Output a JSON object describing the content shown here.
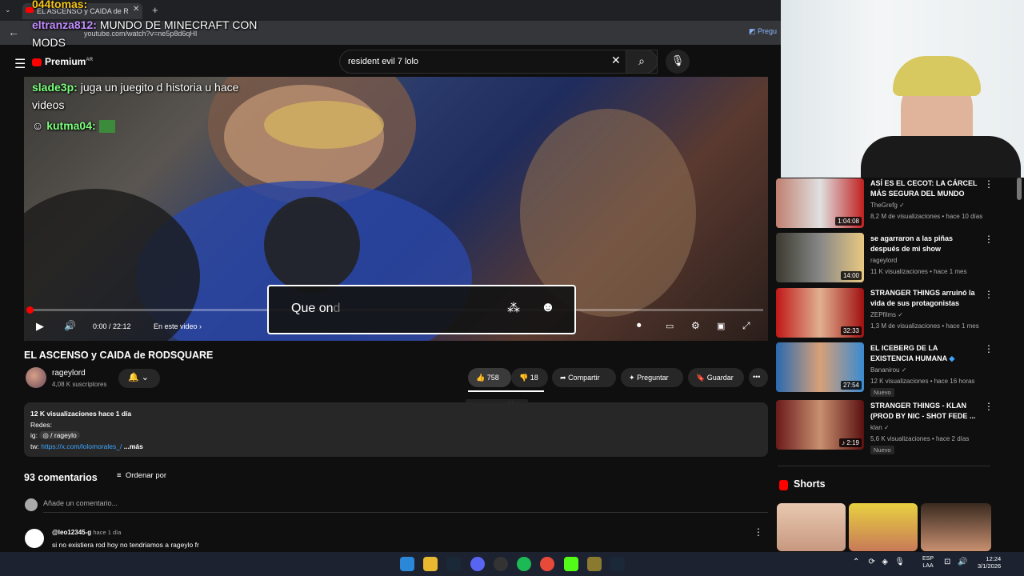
{
  "browser": {
    "tab_title": "EL ASCENSO y CAIDA de R",
    "url": "youtube.com/watch?v=ne5p8d6qHI",
    "translate_label": "Pregu"
  },
  "chat": [
    {
      "user": "044tomas:",
      "text": ""
    },
    {
      "user": "eltranza812:",
      "text": "MUNDO DE MINECRAFT CON"
    },
    {
      "user": "",
      "text": "MODS"
    },
    {
      "user": "slade3p:",
      "text": "juga un juegito d historia u hace"
    },
    {
      "user": "",
      "text": "videos"
    },
    {
      "user": "kutma04:",
      "text": ""
    }
  ],
  "header": {
    "logo": "Premium",
    "logo_region": "AR",
    "search_value": "resident evil 7 lolo"
  },
  "player": {
    "time": "0:00 / 22:12",
    "chapters": "En este video",
    "progress_fraction": 0.0,
    "input_typed": "Que on",
    "input_suggestion": "d"
  },
  "video": {
    "title": "EL ASCENSO y CAIDA de RODSQUARE",
    "channel": "rageylord",
    "subscribers": "4,08 K suscriptores",
    "likes": "758",
    "dislikes": "18",
    "share": "Compartir",
    "ask": "Preguntar",
    "save": "Guardar",
    "like_tooltip": "Me gusta este video"
  },
  "description": {
    "stats": "12 K visualizaciones  hace 1 día",
    "line1": "Redes:",
    "ig_label": "ig:",
    "ig_value": "/ rageylo",
    "tw_label": "tw:",
    "tw_link": "https://x.com/lolomorales_/",
    "more": "...más"
  },
  "comments": {
    "count": "93 comentarios",
    "sort": "Ordenar por",
    "add_placeholder": "Añade un comentario...",
    "items": [
      {
        "user": "@leo12345-g",
        "time": "hace 1 día",
        "text": "si no existiera rod hoy no tendriamos a rageylo fr"
      }
    ]
  },
  "recommendations": [
    {
      "title": "ASÍ ES EL CECOT: LA CÁRCEL MÁS SEGURA DEL MUNDO",
      "channel": "TheGrefg",
      "meta": "8,2 M de visualizaciones • hace 10 días",
      "duration": "1:04:08",
      "badge": ""
    },
    {
      "title": "se agarraron a las piñas después de mi show",
      "channel": "rageylord",
      "meta": "11 K visualizaciones • hace 1 mes",
      "duration": "14:00",
      "badge": ""
    },
    {
      "title": "STRANGER THINGS arruinó la vida de sus protagonistas",
      "channel": "ZEPfilms",
      "meta": "1,3 M de visualizaciones • hace 1 mes",
      "duration": "32:33",
      "badge": ""
    },
    {
      "title": "EL ICEBERG DE LA EXISTENCIA HUMANA",
      "channel": "Bananirou",
      "meta": "12 K visualizaciones • hace 16 horas",
      "duration": "27:54",
      "badge": "Nuevo"
    },
    {
      "title": "STRANGER THINGS - KLAN (PROD BY NIC - SHOT FEDE ...",
      "channel": "klan",
      "meta": "5,6 K visualizaciones • hace 2 días",
      "duration": "2:19",
      "badge": "Nuevo"
    }
  ],
  "shorts": {
    "heading": "Shorts"
  },
  "taskbar": {
    "lang_line1": "ESP",
    "lang_line2": "LAA",
    "time": "12:24",
    "date": "3/1/2026"
  },
  "colors": {
    "accent": "#ff0000",
    "link": "#3ea6ff",
    "bg": "#0f0f0f"
  }
}
